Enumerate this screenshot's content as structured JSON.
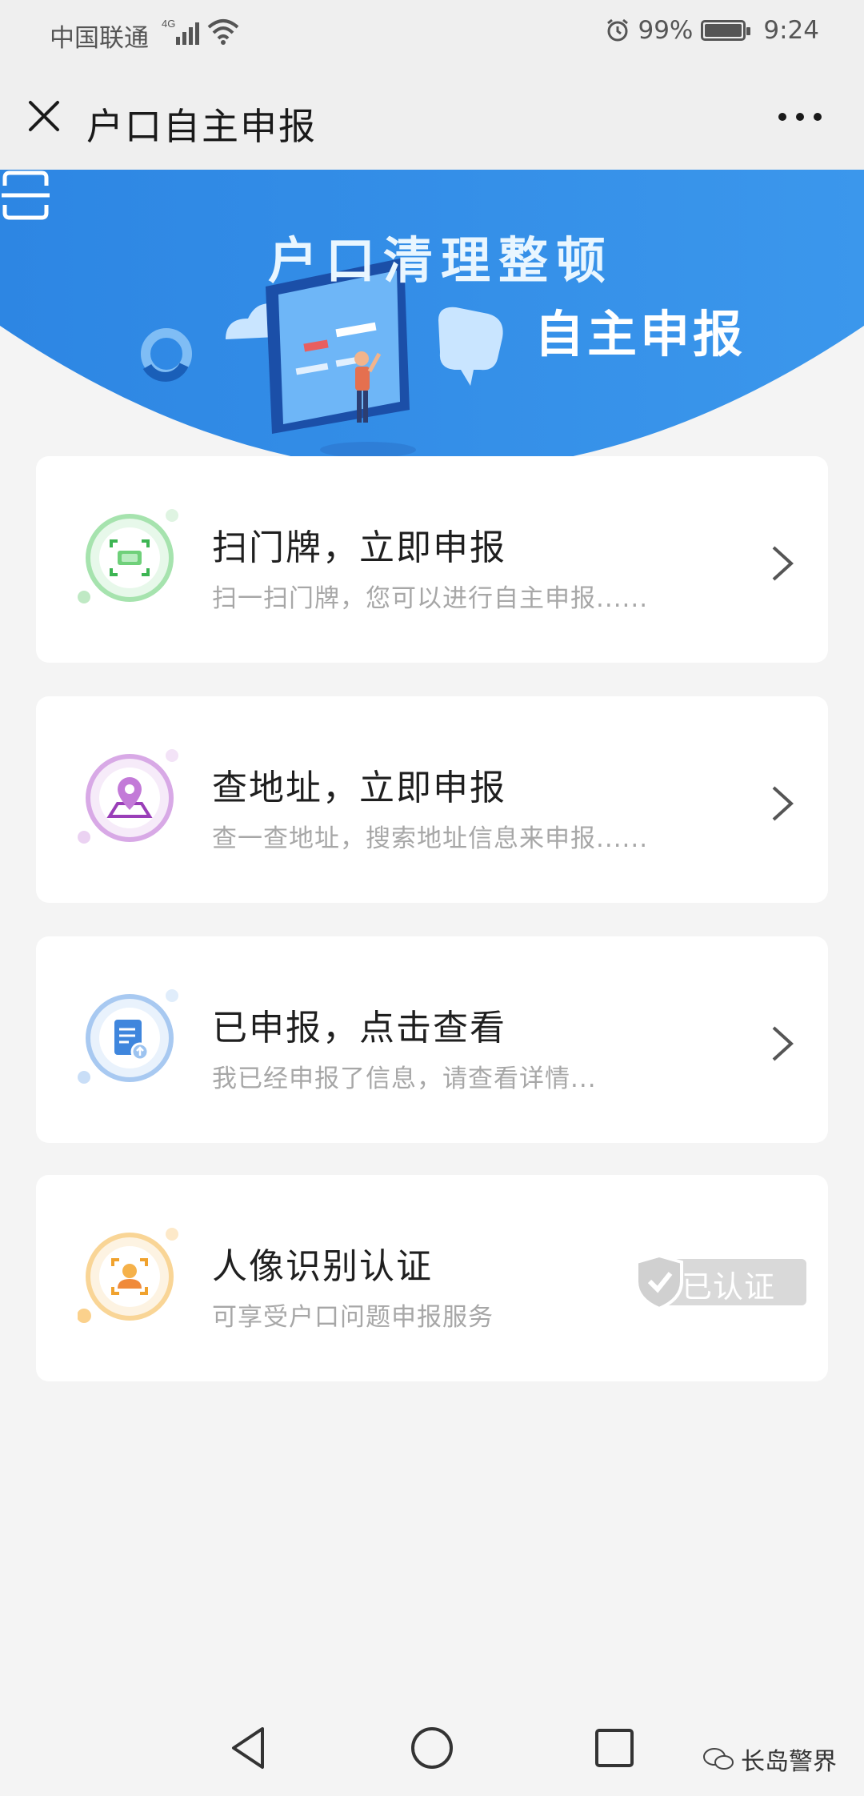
{
  "status_bar": {
    "carrier": "中国联通",
    "network": "4G",
    "battery_percent": "99%",
    "battery_level": 0.99,
    "time": "9:24",
    "icons": [
      "signal-icon",
      "wifi-icon",
      "alarm-icon",
      "battery-icon"
    ]
  },
  "app_bar": {
    "title": "户口自主申报",
    "close_icon": "close-icon",
    "more_icon": "more-icon"
  },
  "banner": {
    "line1": "户口清理整顿",
    "line2": "自主申报",
    "scan_icon": "scan-icon",
    "colors": {
      "primary": "#2f8be6",
      "light": "#5aabf2"
    }
  },
  "cards": [
    {
      "title": "扫门牌，立即申报",
      "subtitle": "扫一扫门牌，您可以进行自主申报......",
      "icon": "scan-doorplate-icon",
      "color": "#6fd07a"
    },
    {
      "title": "查地址，立即申报",
      "subtitle": "查一查地址，搜索地址信息来申报......",
      "icon": "map-location-icon",
      "color": "#c37ad8"
    },
    {
      "title": "已申报，点击查看",
      "subtitle": "我已经申报了信息，请查看详情...",
      "icon": "document-upload-icon",
      "color": "#5b9fe8"
    },
    {
      "title": "人像识别认证",
      "subtitle": "可享受户口问题申报服务",
      "icon": "face-recognition-icon",
      "color": "#f5b14a",
      "badge": "已认证"
    }
  ],
  "nav_bar": {
    "icons": [
      "back-icon",
      "home-icon",
      "recents-icon"
    ]
  },
  "watermark": "长岛警界"
}
